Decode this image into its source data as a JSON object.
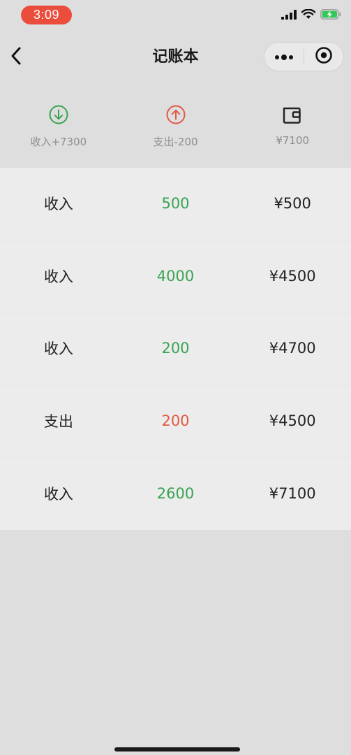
{
  "status_bar": {
    "time": "3:09",
    "battery_color": "#34c759",
    "time_pill_color": "#eb4d3d"
  },
  "nav": {
    "title": "记账本",
    "back_icon": "chevron-left-icon",
    "more_icon": "more-dots-icon",
    "close_icon": "target-circle-icon"
  },
  "summary": {
    "income_label": "收入+7300",
    "income_icon": "arrow-down-circle-icon",
    "income_color": "#3aa351",
    "expense_label": "支出-200",
    "expense_icon": "arrow-up-circle-icon",
    "expense_color": "#e25944",
    "balance_label": "¥7100",
    "balance_icon": "wallet-icon"
  },
  "records": [
    {
      "type": "收入",
      "amount": "500",
      "balance": "¥500",
      "kind": "income"
    },
    {
      "type": "收入",
      "amount": "4000",
      "balance": "¥4500",
      "kind": "income"
    },
    {
      "type": "收入",
      "amount": "200",
      "balance": "¥4700",
      "kind": "income"
    },
    {
      "type": "支出",
      "amount": "200",
      "balance": "¥4500",
      "kind": "expense"
    },
    {
      "type": "收入",
      "amount": "2600",
      "balance": "¥7100",
      "kind": "income"
    }
  ]
}
